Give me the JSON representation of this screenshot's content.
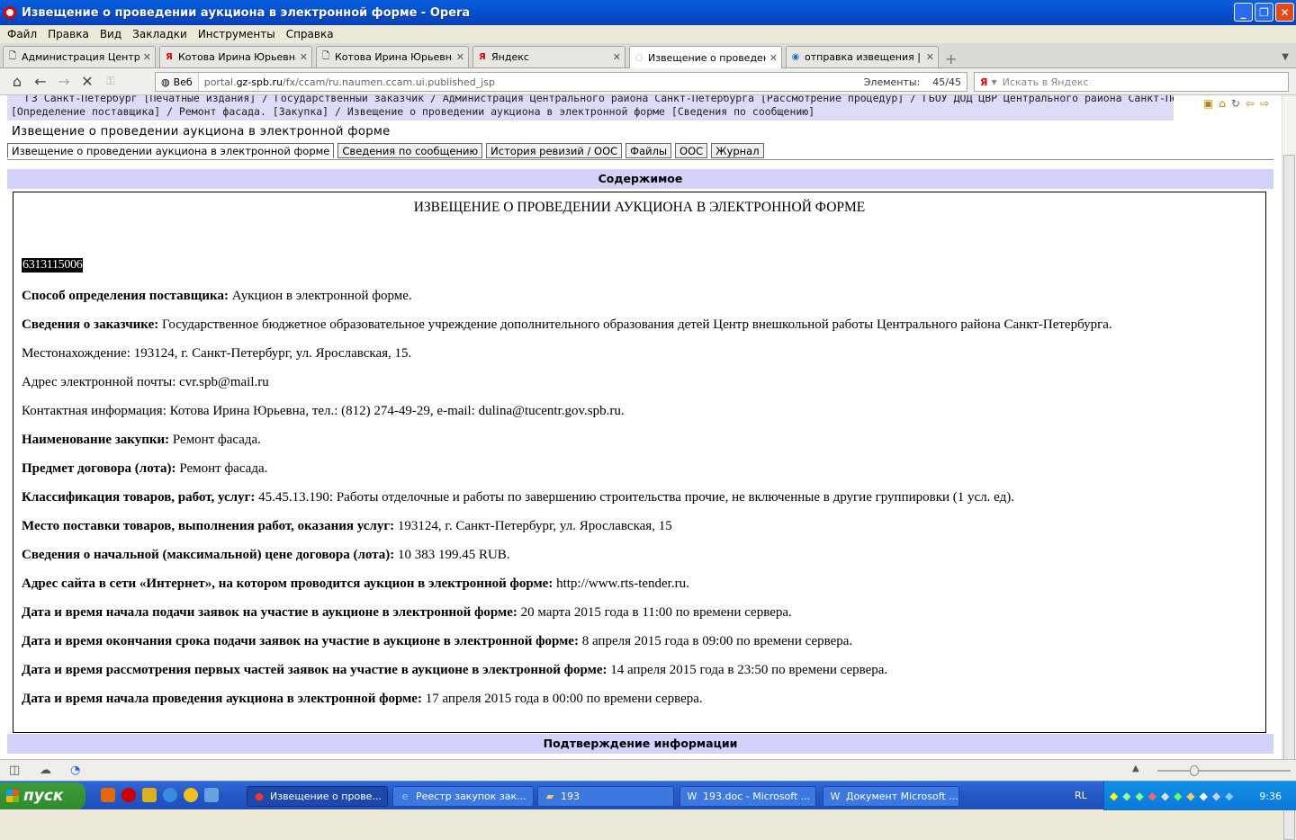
{
  "window": {
    "title": "Извещение о проведении аукциона в электронной форме - Opera",
    "buttons": [
      "_",
      "❐",
      "✕"
    ]
  },
  "menu": [
    "Файл",
    "Правка",
    "Вид",
    "Закладки",
    "Инструменты",
    "Справка"
  ],
  "tabs": [
    {
      "icon": "page-icon",
      "label": "Администрация Центра..."
    },
    {
      "icon": "yandex-icon",
      "label": "Котова Ирина Юрьевна"
    },
    {
      "icon": "page-icon",
      "label": "Котова Ирина Юрьевна"
    },
    {
      "icon": "yandex-icon",
      "label": "Яндекс"
    },
    {
      "icon": "loading-icon",
      "label": "Извещение о проведен..."
    },
    {
      "icon": "globe-icon",
      "label": "отправка извещения | ..."
    }
  ],
  "address": {
    "badge": "Веб",
    "url_prefix": "portal.",
    "url_domain": "gz-spb.ru",
    "url_path": "/fx/ccam/ru.naumen.ccam.ui.published_jsp",
    "elements_label": "Элементы:",
    "elements_value": "45/45"
  },
  "search": {
    "engine": "Я",
    "placeholder": "Искать в Яндекс"
  },
  "page": {
    "breadcrumb_line1": "ГЗ Санкт-Петербург [Печатные издания] / Государственный заказчик / Администрация Центрального района Санкт-Петербурга [Рассмотрение процедур] / ГБОУ ДОД ЦВР Центрального района Санкт-Петербурга",
    "breadcrumb_line2": "[Определение поставщика] / Ремонт фасада. [Закупка] / Извещение о проведении аукциона в электронной форме [Сведения по сообщению]",
    "heading": "Извещение о проведении аукциона в электронной форме",
    "tabs": [
      "Извещение о проведении аукциона в электронной форме",
      "Сведения по сообщению",
      "История ревизий / ООС",
      "Файлы",
      "ООС",
      "Журнал"
    ],
    "section_title": "Содержимое",
    "footer_section": "Подтверждение информации"
  },
  "document": {
    "title": "ИЗВЕЩЕНИЕ О ПРОВЕДЕНИИ АУКЦИОНА В ЭЛЕКТРОННОЙ ФОРМЕ",
    "number": "6313115006",
    "rows": [
      {
        "label": "Способ определения поставщика:",
        "value": " Аукцион в электронной форме."
      },
      {
        "label": "Сведения о заказчике:",
        "value": " Государственное бюджетное образовательное учреждение дополнительного образования детей Центр внешкольной работы Центрального района Санкт-Петербурга."
      },
      {
        "label": "",
        "value": "Местонахождение: 193124, г. Санкт-Петербург, ул. Ярославская, 15."
      },
      {
        "label": "",
        "value": "Адрес электронной почты: cvr.spb@mail.ru"
      },
      {
        "label": "",
        "value": "Контактная информация: Котова Ирина Юрьевна, тел.: (812) 274-49-29, e-mail: dulina@tucentr.gov.spb.ru."
      },
      {
        "label": "Наименование закупки:",
        "value": " Ремонт фасада."
      },
      {
        "label": "Предмет договора (лота):",
        "value": " Ремонт фасада."
      },
      {
        "label": "Классификация товаров, работ, услуг:",
        "value": " 45.45.13.190: Работы отделочные и работы по завершению строительства прочие, не включенные в другие группировки (1 усл. ед)."
      },
      {
        "label": "Место поставки товаров, выполнения работ, оказания услуг:",
        "value": " 193124, г. Санкт-Петербург, ул. Ярославская, 15"
      },
      {
        "label": "Сведения о начальной (максимальной) цене договора (лота):",
        "value": " 10 383 199.45 RUB."
      },
      {
        "label": "Адрес сайта в сети «Интернет», на котором проводится аукцион в электронной форме:",
        "value": " http://www.rts-tender.ru."
      },
      {
        "label": "Дата и время начала подачи заявок на участие в аукционе в электронной форме:",
        "value": " 20 марта 2015 года в 11:00 по времени сервера."
      },
      {
        "label": "Дата и время окончания срока подачи заявок на участие в аукционе в электронной форме:",
        "value": " 8 апреля 2015 года в 09:00 по времени сервера."
      },
      {
        "label": "Дата и время рассмотрения первых частей заявок на участие в аукционе в электронной форме:",
        "value": " 14 апреля 2015 года в 23:50 по времени сервера."
      },
      {
        "label": "Дата и время начала проведения аукциона в электронной форме:",
        "value": " 17 апреля 2015 года в 00:00 по времени сервера."
      }
    ]
  },
  "taskbar": {
    "start": "пуск",
    "items": [
      {
        "label": "Извещение о прове...",
        "active": true
      },
      {
        "label": "Реестр закупок зак...",
        "active": false
      },
      {
        "label": "193",
        "active": false
      },
      {
        "label": "193.doc - Microsoft ...",
        "active": false
      },
      {
        "label": "Документ Microsoft ...",
        "active": false
      }
    ],
    "lang": "RL",
    "clock": "9:36"
  },
  "colors": {
    "accent": "#d2d2fa",
    "breadcrumb_bg": "#dcdcf8",
    "taskbar": "#2457c4"
  }
}
